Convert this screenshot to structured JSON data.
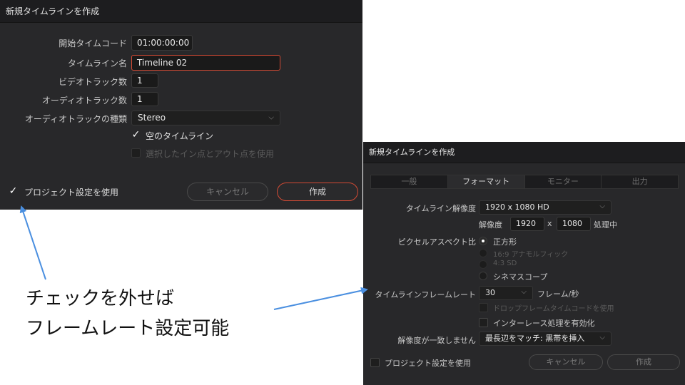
{
  "dialog1": {
    "title": "新規タイムラインを作成",
    "start_tc_label": "開始タイムコード",
    "start_tc_value": "01:00:00:00",
    "timeline_name_label": "タイムライン名",
    "timeline_name_value": "Timeline 02",
    "video_tracks_label": "ビデオトラック数",
    "video_tracks_value": "1",
    "audio_tracks_label": "オーディオトラック数",
    "audio_tracks_value": "1",
    "audio_type_label": "オーディオトラックの種類",
    "audio_type_value": "Stereo",
    "empty_timeline_label": "空のタイムライン",
    "use_in_out_label": "選択したイン点とアウト点を使用",
    "use_project_settings_label": "プロジェクト設定を使用",
    "cancel_label": "キャンセル",
    "create_label": "作成",
    "check_glyph": "✓",
    "chevron_glyph": "⌵"
  },
  "dialog2": {
    "title": "新規タイムラインを作成",
    "tabs": [
      {
        "label": "一般"
      },
      {
        "label": "フォーマット"
      },
      {
        "label": "モニター"
      },
      {
        "label": "出力"
      }
    ],
    "resolution_label": "タイムライン解像度",
    "resolution_value": "1920 x 1080 HD",
    "res_label": "解像度",
    "res_width": "1920",
    "res_x": "x",
    "res_height": "1080",
    "processing_label": "処理中",
    "pixel_aspect_label": "ピクセルアスペクト比",
    "pixel_options": [
      {
        "label": "正方形"
      },
      {
        "label": "16:9 アナモルフィック"
      },
      {
        "label": "4:3 SD"
      },
      {
        "label": "シネマスコープ"
      }
    ],
    "framerate_label": "タイムラインフレームレート",
    "framerate_value": "30",
    "framerate_unit": "フレーム/秒",
    "dropframe_label": "ドロップフレームタイムコードを使用",
    "interlace_label": "インターレース処理を有効化",
    "mismatch_label": "解像度が一致しません",
    "mismatch_value": "最長辺をマッチ: 黒帯を挿入",
    "use_project_settings_label": "プロジェクト設定を使用",
    "cancel_label": "キャンセル",
    "create_label": "作成",
    "chevron_glyph": "⌵"
  },
  "annotation": {
    "line1": "チェックを外せば",
    "line2": "フレームレート設定可能",
    "arrow_color": "#4a8fe0"
  },
  "colors": {
    "accent": "#d24a34",
    "dialog_bg": "#28282a",
    "title_bg": "#1d1d1f"
  }
}
